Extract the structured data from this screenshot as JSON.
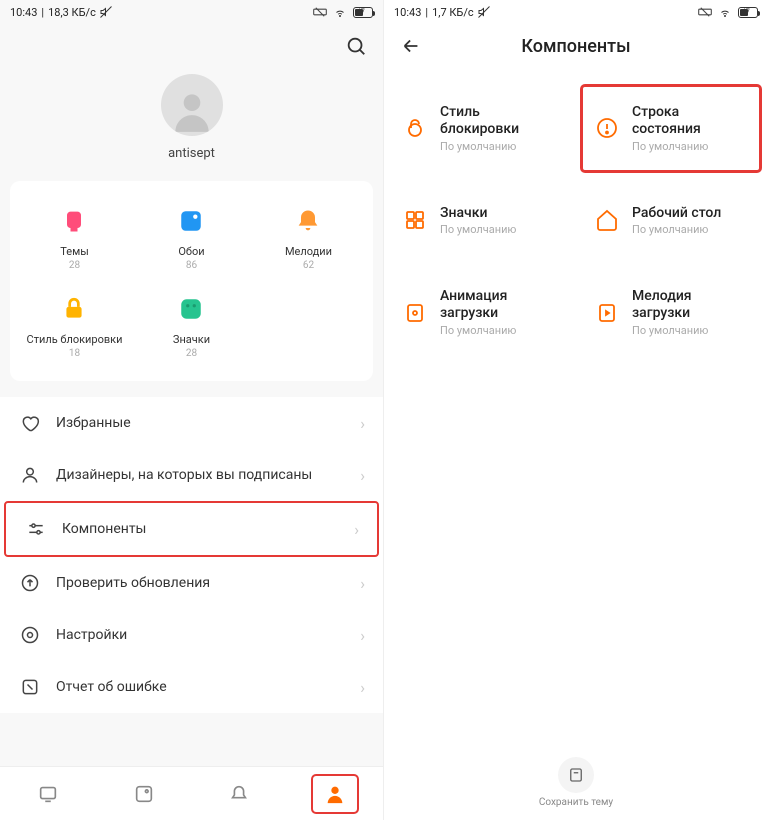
{
  "left": {
    "status": {
      "time": "10:43",
      "speed": "18,3 КБ/с",
      "battery": "47"
    },
    "username": "antisept",
    "grid": [
      {
        "label": "Темы",
        "count": "28"
      },
      {
        "label": "Обои",
        "count": "86"
      },
      {
        "label": "Мелодии",
        "count": "62"
      },
      {
        "label": "Стиль блокировки",
        "count": "18"
      },
      {
        "label": "Значки",
        "count": "28"
      }
    ],
    "menu": [
      "Избранные",
      "Дизайнеры, на которых вы подписаны",
      "Компоненты",
      "Проверить обновления",
      "Настройки",
      "Отчет об ошибке"
    ]
  },
  "right": {
    "status": {
      "time": "10:43",
      "speed": "1,7 КБ/с",
      "battery": "47"
    },
    "title": "Компоненты",
    "items": [
      {
        "title": "Стиль блокировки",
        "sub": "По умолчанию"
      },
      {
        "title": "Строка состояния",
        "sub": "По умолчанию"
      },
      {
        "title": "Значки",
        "sub": "По умолчанию"
      },
      {
        "title": "Рабочий стол",
        "sub": "По умолчанию"
      },
      {
        "title": "Анимация загрузки",
        "sub": "По умолчанию"
      },
      {
        "title": "Мелодия загрузки",
        "sub": "По умолчанию"
      }
    ],
    "save_label": "Сохранить тему"
  }
}
